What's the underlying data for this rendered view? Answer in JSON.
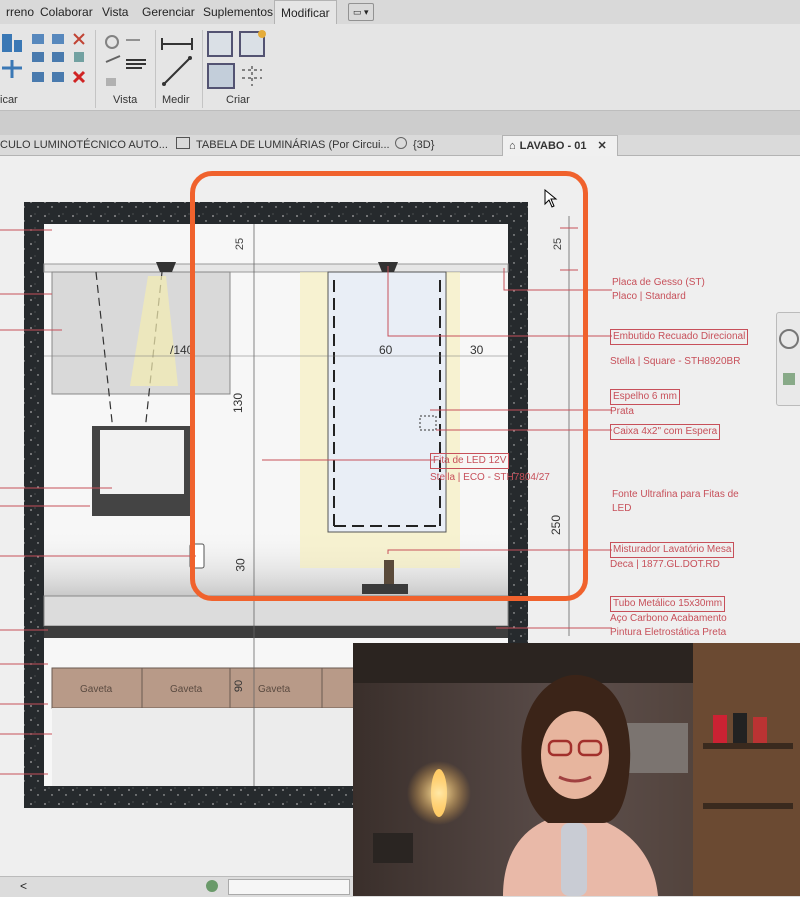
{
  "ribbon": {
    "tabs": [
      "rreno",
      "Colaborar",
      "Vista",
      "Gerenciar",
      "Suplementos",
      "Modificar"
    ],
    "active_tab": "Modificar",
    "groups": [
      {
        "label": "icar"
      },
      {
        "label": "Vista"
      },
      {
        "label": "Medir"
      },
      {
        "label": "Criar"
      }
    ]
  },
  "doc_tabs": [
    {
      "label": "CULO LUMINOTÉCNICO AUTO...",
      "icon": "plan-view-icon"
    },
    {
      "label": "TABELA DE LUMINÁRIAS (Por Circui...",
      "icon": "schedule-icon"
    },
    {
      "label": "{3D}",
      "icon": "3d-view-icon"
    },
    {
      "label": "LAVABO - 01",
      "icon": "home-icon",
      "active": true,
      "close": "✕"
    }
  ],
  "drawing": {
    "dimensions": {
      "top_25_left": "25",
      "top_25_right": "25",
      "width_140": "/140",
      "width_60": "60",
      "width_30": "30",
      "height_130": "130",
      "height_30": "30",
      "height_250": "250",
      "drawer_90": "90"
    },
    "drawers": [
      "Gaveta",
      "Gaveta",
      "Gaveta"
    ],
    "labels": [
      {
        "title": "Placa de Gesso (ST)",
        "sub": "Placo | Standard",
        "boxed": false
      },
      {
        "title": "Embutido Recuado Direcional",
        "sub": "Stella | Square - STH8920BR",
        "boxed": true
      },
      {
        "title": "Espelho 6 mm",
        "sub": "Prata",
        "boxed": true
      },
      {
        "title": "Caixa 4x2\" com Espera",
        "sub": "",
        "boxed": true
      },
      {
        "title": "Fita de LED 12V",
        "sub": "Stella | ECO - STH7804/27",
        "boxed": true
      },
      {
        "title": "Fonte Ultrafina para Fitas de",
        "sub": "LED",
        "boxed": false
      },
      {
        "title": "Misturador Lavatório Mesa",
        "sub": "Deca | 1877.GL.DOT.RD",
        "boxed": true
      },
      {
        "title": "Tubo Metálico 15x30mm",
        "sub": "Aço Carbono Acabamento",
        "sub2": "Pintura Eletrostática Preta",
        "boxed": true
      }
    ]
  },
  "colors": {
    "highlight": "#f0622d",
    "leader": "#c7505a",
    "granite": "#262a2d",
    "cabinet": "#d8d8d8",
    "drawer": "#b89a88",
    "light_cone": "#f5eba0"
  },
  "statusbar": {
    "arrow": "<"
  }
}
